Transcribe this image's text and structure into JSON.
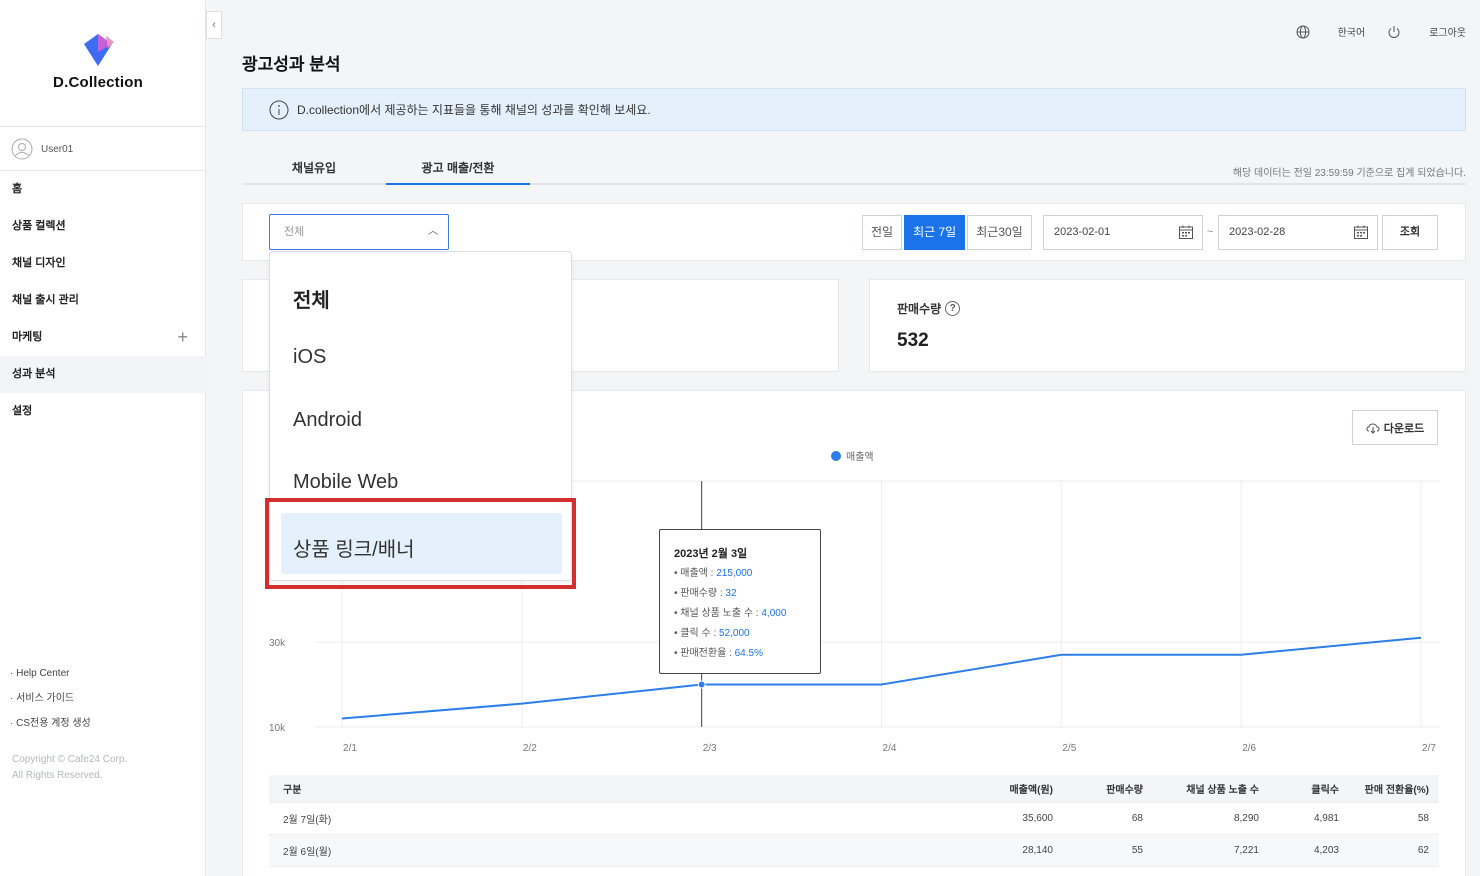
{
  "brand": {
    "name": "D.Collection",
    "accent": "#1a73e8"
  },
  "user": {
    "name": "User01"
  },
  "nav": [
    {
      "label": "홈"
    },
    {
      "label": "상품 컬렉션"
    },
    {
      "label": "채널 디자인"
    },
    {
      "label": "채널 출시 관리"
    },
    {
      "label": "마케팅",
      "expand": "+"
    },
    {
      "label": "성과 분석",
      "active": true
    },
    {
      "label": "설정"
    }
  ],
  "side_links": [
    "Help Center",
    "서비스 가이드",
    "CS전용 계정 생성"
  ],
  "copyright": {
    "line1": "Copyright © Cafe24 Corp.",
    "line2": "All Rights Reserved."
  },
  "header": {
    "language": "한국어",
    "logout": "로그아웃"
  },
  "page": {
    "title": "광고성과 분석",
    "info": "D.collection에서 제공하는 지표들을 통해 채널의 성과를 확인해 보세요."
  },
  "tabs": [
    {
      "label": "채널유입",
      "active": false
    },
    {
      "label": "광고 매출/전환",
      "active": true
    }
  ],
  "tab_note": "해당 데이터는 전일 23:59:59 기준으로 집계 되었습니다.",
  "filter": {
    "select_value": "전체",
    "periods": [
      "전일",
      "최근 7일",
      "최근30일"
    ],
    "active_period": "최근 7일",
    "date_from": "2023-02-01",
    "date_to": "2023-02-28",
    "tilde": "~",
    "search": "조회"
  },
  "dropdown": {
    "options": [
      "전체",
      "iOS",
      "Android",
      "Mobile Web",
      "상품 링크/배너"
    ],
    "highlighted": "상품 링크/배너"
  },
  "kpi": {
    "label": "판매수량",
    "help": "?",
    "value": "532"
  },
  "download": "다운로드",
  "chart_data": {
    "type": "line",
    "x": [
      "2/1",
      "2/2",
      "2/3",
      "2/4",
      "2/5",
      "2/6",
      "2/7"
    ],
    "series": [
      {
        "name": "매출액",
        "values": [
          12000,
          15500,
          20000,
          20000,
          27000,
          27000,
          31000
        ],
        "color": "#2d7ee8"
      }
    ],
    "y_ticks": [
      "10k",
      "30k"
    ],
    "grid": true,
    "legend": "top-center"
  },
  "tooltip": {
    "title": "2023년 2월 3일",
    "rows": [
      {
        "label": "매출액 : ",
        "value": "215,000"
      },
      {
        "label": "판매수량 : ",
        "value": "32"
      },
      {
        "label": "채널 상품 노출 수 : ",
        "value": "4,000"
      },
      {
        "label": "클릭 수 : ",
        "value": "52,000"
      },
      {
        "label": "판매전환율 : ",
        "value": "64.5%"
      }
    ]
  },
  "table": {
    "headers": [
      "구분",
      "매출액(원)",
      "판매수량",
      "채널 상품 노출 수",
      "클릭수",
      "판매 전환율(%)"
    ],
    "rows": [
      [
        "2월 7일(화)",
        "35,600",
        "68",
        "8,290",
        "4,981",
        "58"
      ],
      [
        "2월 6일(월)",
        "28,140",
        "55",
        "7,221",
        "4,203",
        "62"
      ]
    ]
  }
}
